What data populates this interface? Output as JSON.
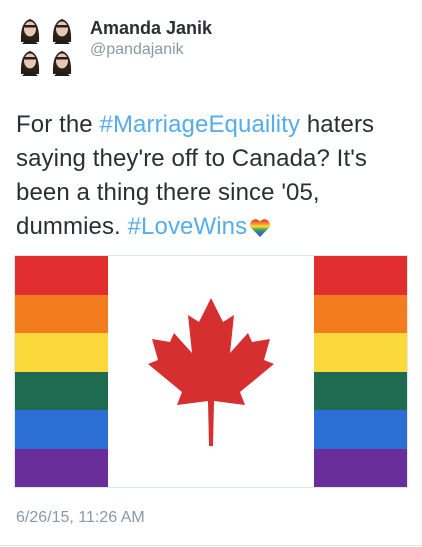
{
  "author": {
    "name": "Amanda Janik",
    "handle": "@pandajanik"
  },
  "tweet": {
    "text_parts": [
      "For the ",
      "#MarriageEquaility",
      " haters saying they're off to Canada? It's been a thing there since '05, dummies. ",
      "#LoveWins"
    ],
    "timestamp": "6/26/15, 11:26 AM",
    "hashtag_color": "#55acee",
    "emoji": "rainbow-heart-icon"
  },
  "flag": {
    "stripe_colors": [
      "#e22e2e",
      "#f37c1f",
      "#fcd93a",
      "#1e6b52",
      "#2c6fd4",
      "#6a2e9b"
    ],
    "leaf_color": "#d62f2f"
  }
}
